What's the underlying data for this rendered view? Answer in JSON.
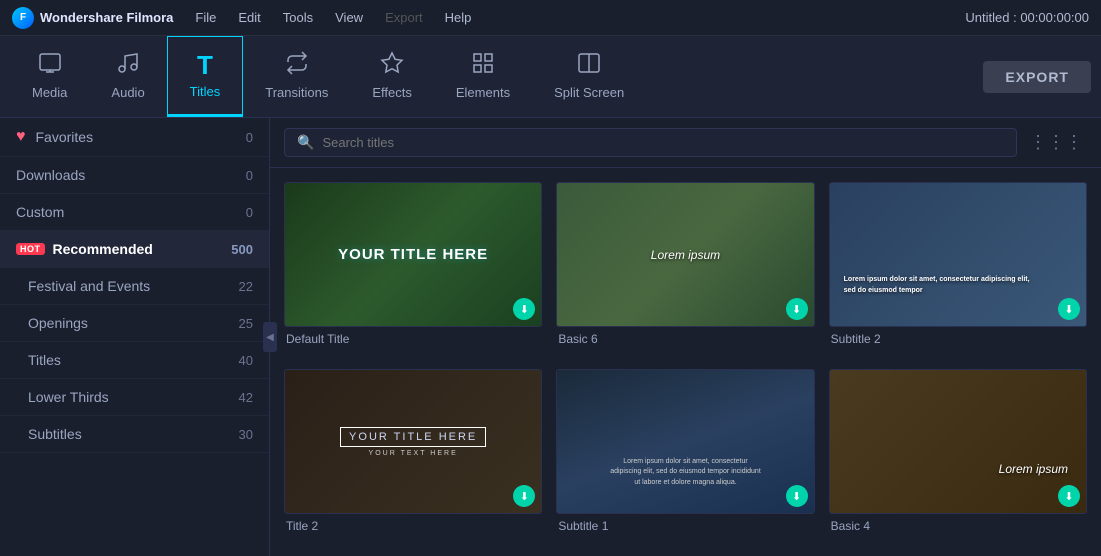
{
  "app": {
    "name": "Wondershare Filmora",
    "title": "Untitled : 00:00:00:00"
  },
  "menu": {
    "items": [
      "File",
      "Edit",
      "Tools",
      "View",
      "Export",
      "Help"
    ],
    "export_disabled": true
  },
  "toolbar": {
    "items": [
      {
        "id": "media",
        "label": "Media",
        "icon": "⬜"
      },
      {
        "id": "audio",
        "label": "Audio",
        "icon": "♪"
      },
      {
        "id": "titles",
        "label": "Titles",
        "icon": "T",
        "active": true
      },
      {
        "id": "transitions",
        "label": "Transitions",
        "icon": "↔"
      },
      {
        "id": "effects",
        "label": "Effects",
        "icon": "✦"
      },
      {
        "id": "elements",
        "label": "Elements",
        "icon": "⬡"
      },
      {
        "id": "split-screen",
        "label": "Split Screen",
        "icon": "⧉"
      }
    ],
    "export_label": "EXPORT"
  },
  "sidebar": {
    "items": [
      {
        "id": "favorites",
        "label": "Favorites",
        "count": "0",
        "heart": true
      },
      {
        "id": "downloads",
        "label": "Downloads",
        "count": "0"
      },
      {
        "id": "custom",
        "label": "Custom",
        "count": "0"
      },
      {
        "id": "recommended",
        "label": "Recommended",
        "count": "500",
        "hot": true,
        "active": true
      },
      {
        "id": "festival-events",
        "label": "Festival and Events",
        "count": "22"
      },
      {
        "id": "openings",
        "label": "Openings",
        "count": "25"
      },
      {
        "id": "titles",
        "label": "Titles",
        "count": "40"
      },
      {
        "id": "lower-thirds",
        "label": "Lower Thirds",
        "count": "42"
      },
      {
        "id": "subtitles",
        "label": "Subtitles",
        "count": "30"
      }
    ]
  },
  "search": {
    "placeholder": "Search titles"
  },
  "grid": {
    "cards": [
      {
        "id": "default-title",
        "label": "Default Title",
        "main_text": "YOUR TITLE HERE",
        "style": "outlined",
        "bg": "vine"
      },
      {
        "id": "basic-6",
        "label": "Basic 6",
        "main_text": "Lorem ipsum",
        "style": "plain",
        "bg": "nature1"
      },
      {
        "id": "subtitle-2",
        "label": "Subtitle 2",
        "main_text": "",
        "style": "subtitle",
        "bg": "nature2"
      },
      {
        "id": "title-2",
        "label": "Title 2",
        "main_text": "YOUR TITLE HERE",
        "sub_text": "YOUR TEXT HERE",
        "style": "outlined-box",
        "bg": "warm"
      },
      {
        "id": "subtitle-1",
        "label": "Subtitle 1",
        "main_text": "",
        "style": "lorem-para",
        "bg": "mountains"
      },
      {
        "id": "basic-4",
        "label": "Basic 4",
        "main_text": "Lorem ipsum",
        "style": "plain-right",
        "bg": "desert"
      }
    ]
  }
}
